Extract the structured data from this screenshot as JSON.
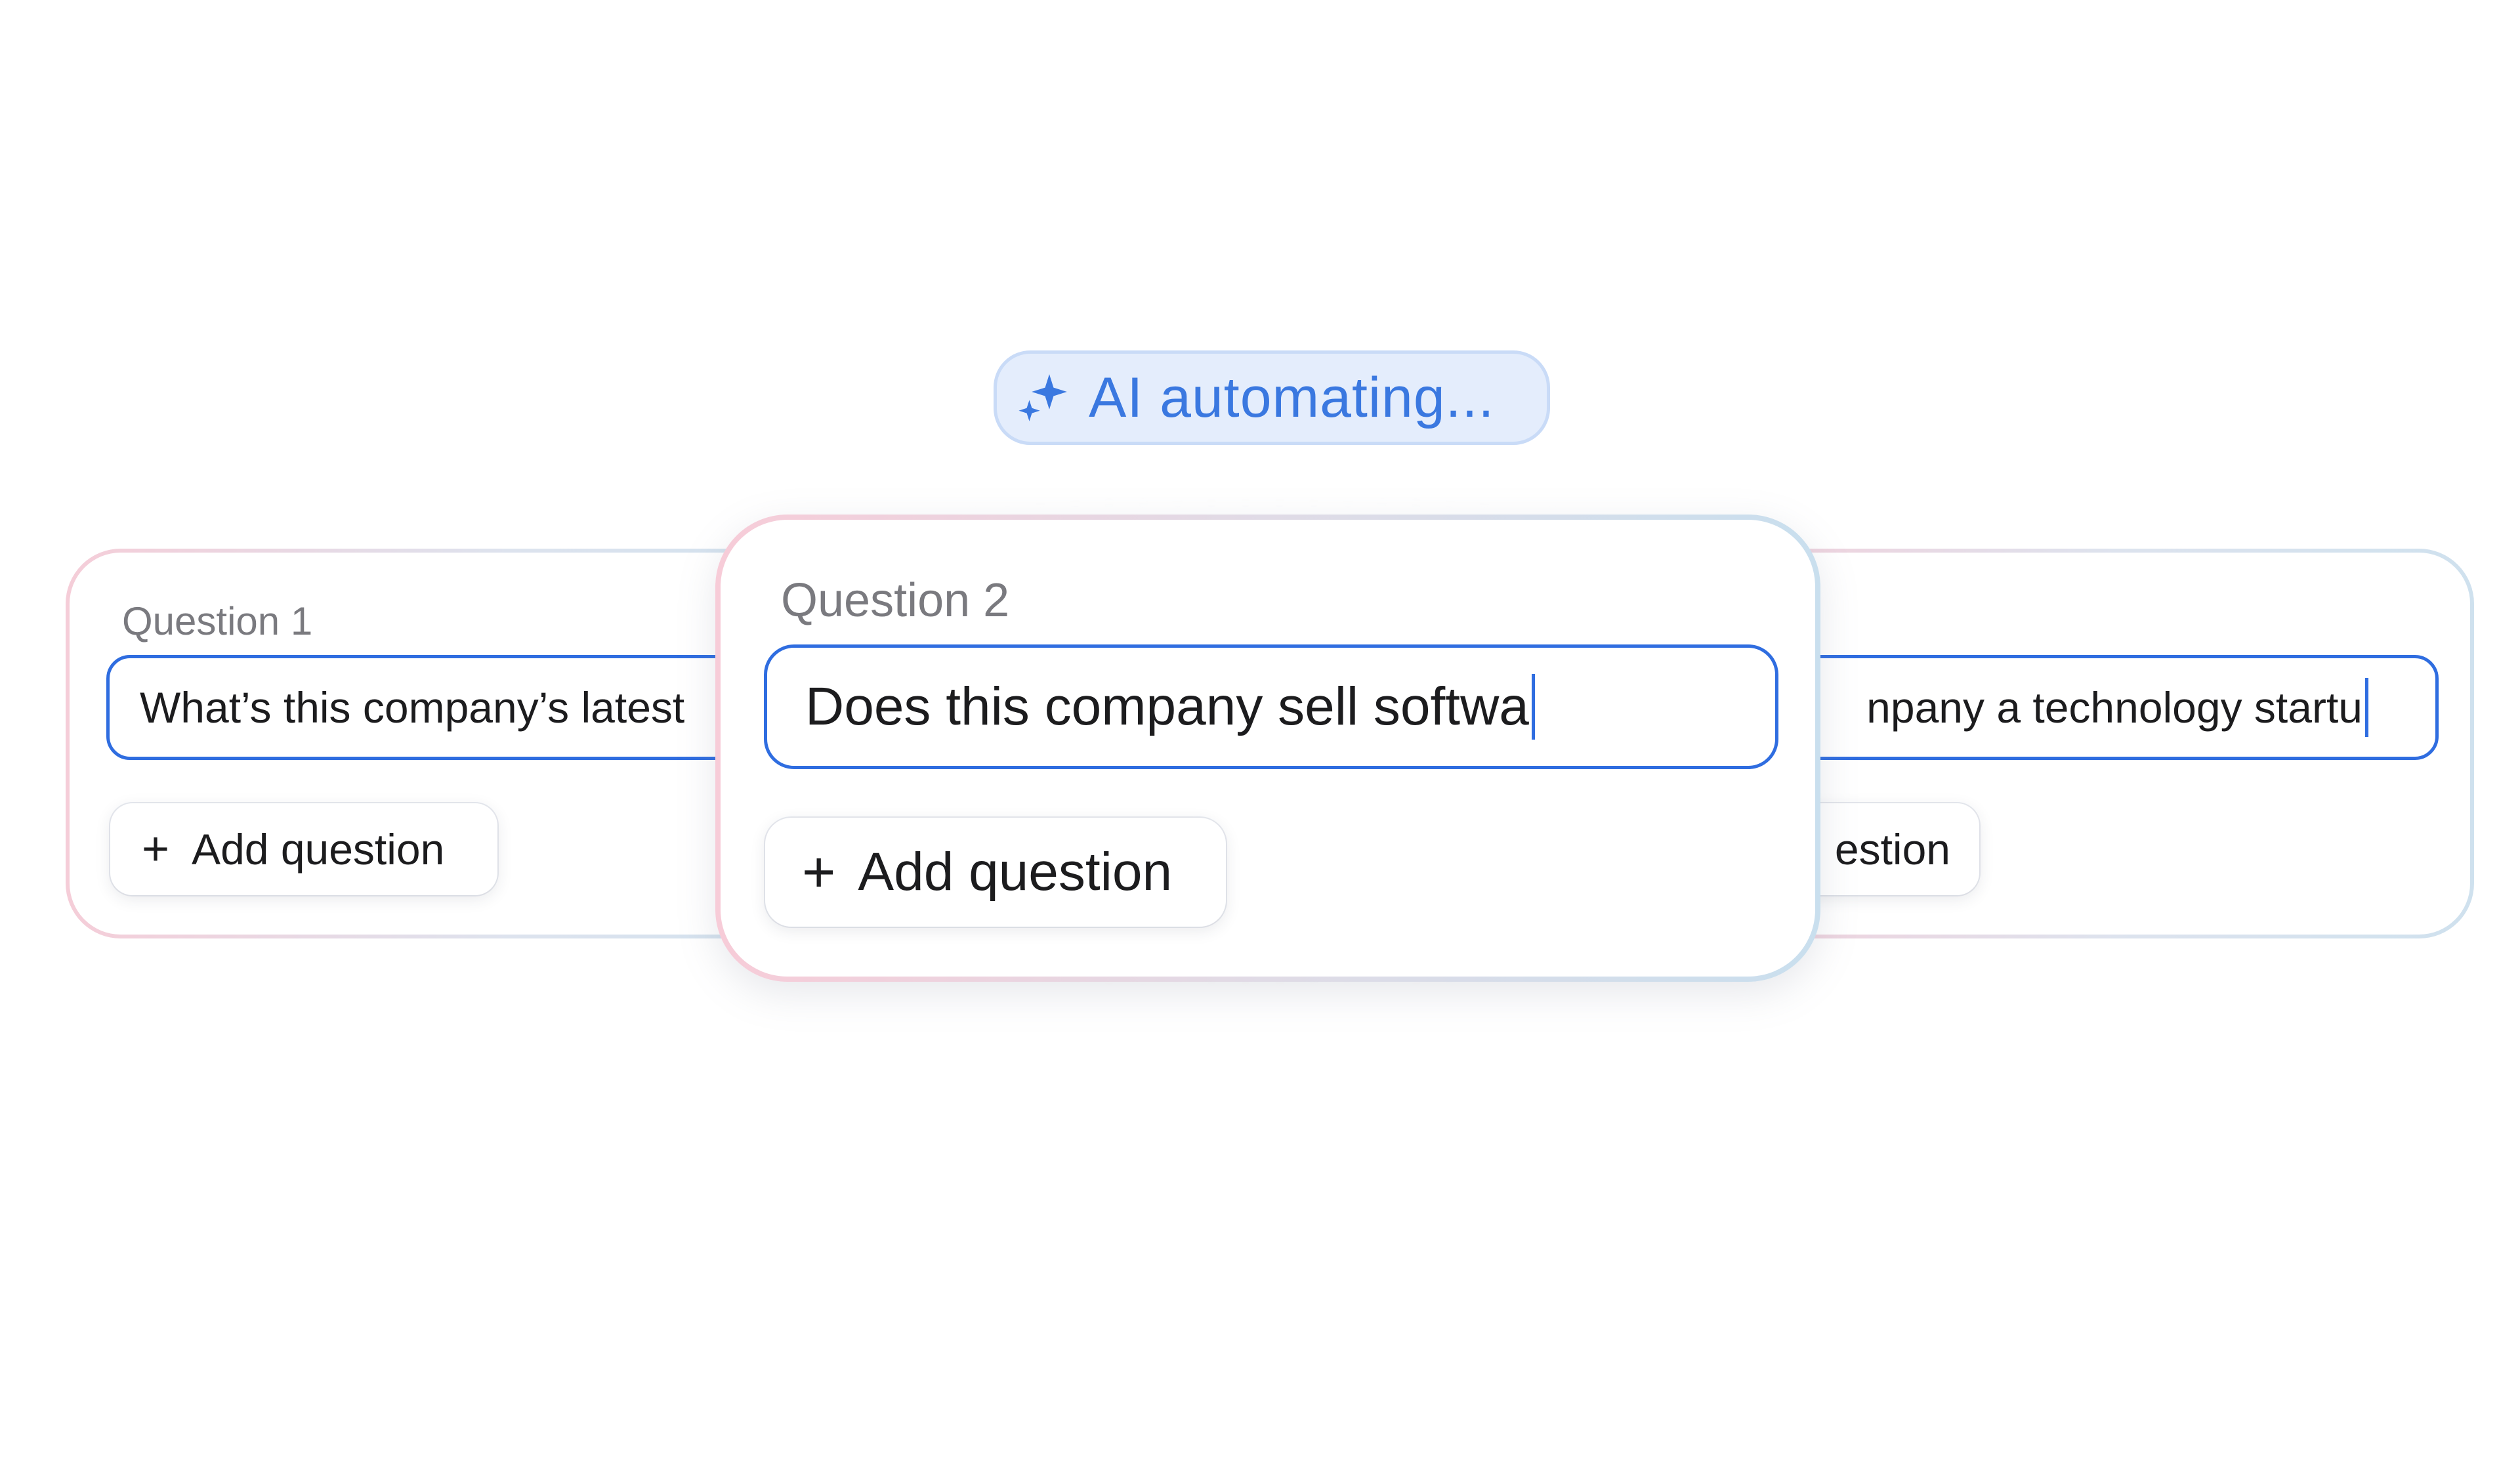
{
  "status": {
    "label": "AI automating...",
    "icon": "sparkles-icon",
    "color": "#3a78e0"
  },
  "cards": {
    "left": {
      "label": "Question 1",
      "input_value": "What’s this company’s latest",
      "add_label": "Add question"
    },
    "center": {
      "label": "Question 2",
      "input_value": "Does this company sell softwa",
      "add_label": "Add question"
    },
    "right": {
      "input_value": "npany a technology startu",
      "add_label": "estion"
    }
  },
  "colors": {
    "input_border": "#2f6de0",
    "pill_background": "#e4edfc"
  }
}
